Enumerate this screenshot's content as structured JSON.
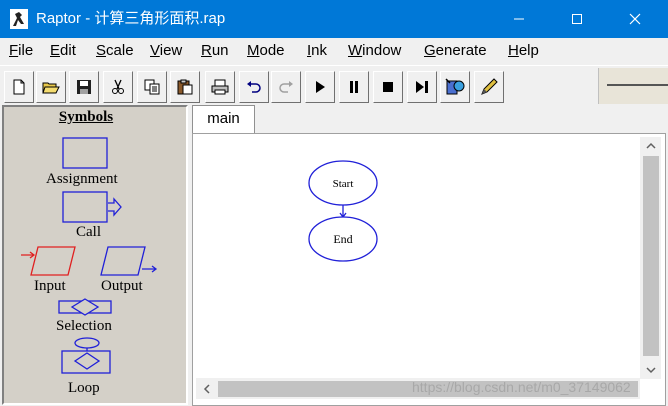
{
  "window": {
    "title": "Raptor - 计算三角形面积.rap",
    "controls": {
      "minimize_icon": "minimize-icon",
      "maximize_icon": "maximize-icon",
      "close_icon": "close-icon"
    },
    "titlebar_color": "#0078d7"
  },
  "menu": [
    {
      "accel": "F",
      "rest": "ile"
    },
    {
      "accel": "E",
      "rest": "dit"
    },
    {
      "accel": "S",
      "rest": "cale"
    },
    {
      "accel": "V",
      "rest": "iew"
    },
    {
      "accel": "R",
      "rest": "un"
    },
    {
      "accel": "M",
      "rest": "ode"
    },
    {
      "accel": "I",
      "rest": "nk"
    },
    {
      "accel": "W",
      "rest": "indow"
    },
    {
      "accel": "G",
      "rest": "enerate"
    },
    {
      "accel": "H",
      "rest": "elp"
    }
  ],
  "toolbar": {
    "buttons": [
      "new-file-icon",
      "open-folder-icon",
      "save-icon",
      "cut-icon",
      "copy-icon",
      "paste-icon",
      "print-icon",
      "undo-icon",
      "redo-icon",
      "play-icon",
      "pause-icon",
      "stop-icon",
      "step-icon",
      "test-server-icon",
      "pen-ink-icon"
    ]
  },
  "symbols": {
    "title": "Symbols",
    "assignment": "Assignment",
    "call": "Call",
    "input": "Input",
    "output": "Output",
    "selection": "Selection",
    "loop": "Loop"
  },
  "tabs": [
    {
      "label": "main"
    }
  ],
  "flowchart": {
    "start": "Start",
    "end": "End",
    "color": "#2020d8"
  },
  "watermark": "https://blog.csdn.net/m0_37149062"
}
